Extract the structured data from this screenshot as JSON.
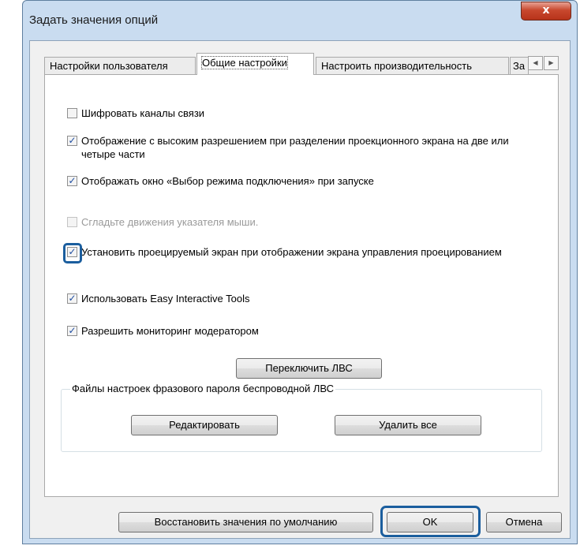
{
  "window": {
    "title": "Задать значения опций",
    "close_glyph": "x"
  },
  "tabs": [
    {
      "label": "Настройки пользователя",
      "active": false
    },
    {
      "label": "Общие настройки",
      "active": true
    },
    {
      "label": "Настроить производительность",
      "active": false
    },
    {
      "label": "За",
      "active": false
    }
  ],
  "tab_scroll": {
    "left_glyph": "◀",
    "right_glyph": "▶"
  },
  "options": [
    {
      "label": "Шифровать каналы связи",
      "checked": false,
      "enabled": true
    },
    {
      "label": "Отображение с высоким разрешением при разделении проекционного экрана на две или четыре части",
      "checked": true,
      "enabled": true
    },
    {
      "label": "Отображать окно «Выбор режима подключения» при запуске",
      "checked": true,
      "enabled": true
    },
    {
      "label": "Сгладьте движения указателя мыши.",
      "checked": false,
      "enabled": false
    },
    {
      "label": "Установить проецируемый экран при отображении экрана управления проецированием",
      "checked": true,
      "enabled": true
    },
    {
      "label": "Использовать Easy Interactive Tools",
      "checked": true,
      "enabled": true
    },
    {
      "label": "Разрешить мониторинг модератором",
      "checked": true,
      "enabled": true
    }
  ],
  "check_glyph": "✓",
  "switch_lan_button": "Переключить ЛВС",
  "wireless_group": {
    "title": "Файлы настроек фразового пароля беспроводной ЛВС",
    "edit_button": "Редактировать",
    "delete_all_button": "Удалить все"
  },
  "footer": {
    "restore_defaults_button": "Восстановить значения по умолчанию",
    "ok_button": "OK",
    "cancel_button": "Отмена"
  },
  "colors": {
    "highlight": "#1b5e9e",
    "check": "#1e4da1",
    "frame": "#c9dcf0"
  }
}
